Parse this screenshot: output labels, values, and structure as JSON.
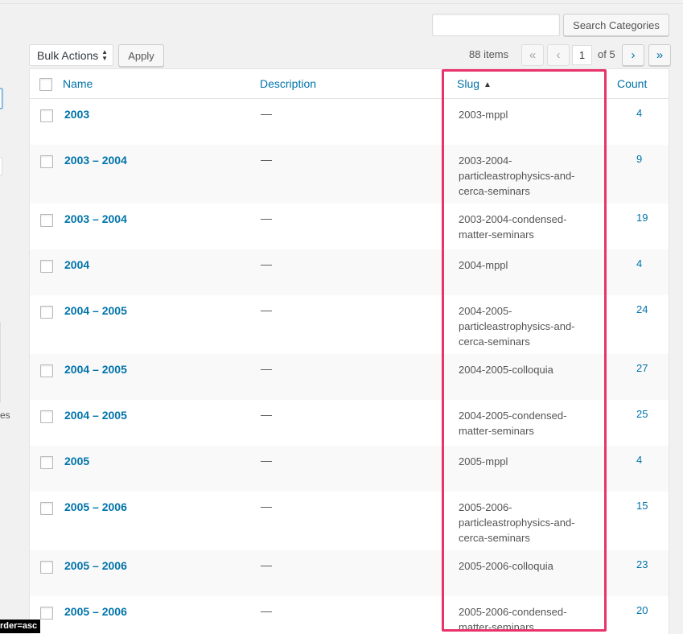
{
  "search": {
    "button_label": "Search Categories",
    "value": ""
  },
  "bulk": {
    "select_value": "Bulk Actions",
    "apply_label": "Apply"
  },
  "pagination": {
    "items_count": "88 items",
    "first": "«",
    "prev": "‹",
    "current_page": "1",
    "of_label": "of 5",
    "next": "›",
    "last": "»"
  },
  "left_fragment": {
    "text": "es"
  },
  "columns": {
    "name": "Name",
    "description": "Description",
    "slug": "Slug",
    "slug_sort_indicator": "▲",
    "count": "Count"
  },
  "rows": [
    {
      "name": "2003",
      "description": "—",
      "slug_lines": [
        "2003-mppl"
      ],
      "count": "4"
    },
    {
      "name": "2003 – 2004",
      "description": "—",
      "slug_lines": [
        "2003-2004-",
        "particleastrophysics-and-",
        "cerca-seminars"
      ],
      "count": "9"
    },
    {
      "name": "2003 – 2004",
      "description": "—",
      "slug_lines": [
        "2003-2004-condensed-",
        "matter-seminars"
      ],
      "count": "19"
    },
    {
      "name": "2004",
      "description": "—",
      "slug_lines": [
        "2004-mppl"
      ],
      "count": "4"
    },
    {
      "name": "2004 – 2005",
      "description": "—",
      "slug_lines": [
        "2004-2005-",
        "particleastrophysics-and-",
        "cerca-seminars"
      ],
      "count": "24"
    },
    {
      "name": "2004 – 2005",
      "description": "—",
      "slug_lines": [
        "2004-2005-colloquia"
      ],
      "count": "27"
    },
    {
      "name": "2004 – 2005",
      "description": "—",
      "slug_lines": [
        "2004-2005-condensed-",
        "matter-seminars"
      ],
      "count": "25"
    },
    {
      "name": "2005",
      "description": "—",
      "slug_lines": [
        "2005-mppl"
      ],
      "count": "4"
    },
    {
      "name": "2005 – 2006",
      "description": "—",
      "slug_lines": [
        "2005-2006-",
        "particleastrophysics-and-",
        "cerca-seminars"
      ],
      "count": "15"
    },
    {
      "name": "2005 – 2006",
      "description": "—",
      "slug_lines": [
        "2005-2006-colloquia"
      ],
      "count": "23"
    },
    {
      "name": "2005 – 2006",
      "description": "—",
      "slug_lines": [
        "2005-2006-condensed-",
        "matter-seminars"
      ],
      "count": "20"
    }
  ],
  "status_bar": {
    "url_fragment": "rder=asc"
  },
  "colors": {
    "link": "#0073aa",
    "highlight_border": "#e8336b",
    "alt_row": "#f9f9f9"
  }
}
